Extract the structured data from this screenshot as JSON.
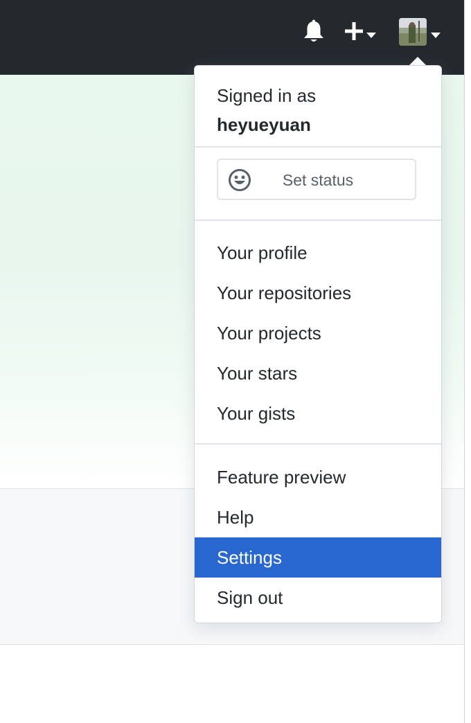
{
  "header": {
    "notifications_icon": "bell-icon",
    "create_icon": "plus-icon",
    "create_caret_icon": "caret-down-icon",
    "avatar_icon": "avatar",
    "avatar_caret_icon": "caret-down-icon",
    "background_color": "#24292e"
  },
  "dropdown": {
    "signed_in_label": "Signed in as",
    "username": "heyueyuan",
    "set_status": {
      "icon": "smiley-icon",
      "label": "Set status"
    },
    "profile_items": [
      {
        "label": "Your profile"
      },
      {
        "label": "Your repositories"
      },
      {
        "label": "Your projects"
      },
      {
        "label": "Your stars"
      },
      {
        "label": "Your gists"
      }
    ],
    "other_items": [
      {
        "label": "Feature preview"
      },
      {
        "label": "Help"
      },
      {
        "label": "Settings",
        "active": true
      },
      {
        "label": "Sign out"
      }
    ],
    "active_color": "#2867cf"
  }
}
